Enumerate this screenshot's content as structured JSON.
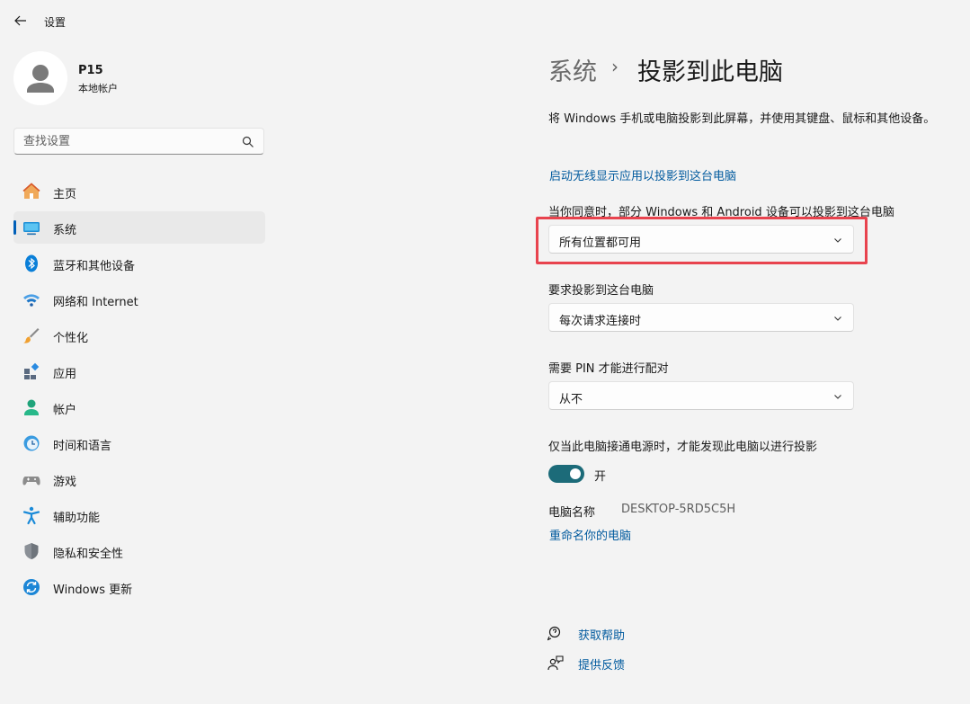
{
  "window": {
    "title": "设置"
  },
  "user": {
    "name": "P15",
    "account_type": "本地帐户"
  },
  "search": {
    "placeholder": "查找设置"
  },
  "sidebar": {
    "items": [
      {
        "label": "主页",
        "icon": "home-icon"
      },
      {
        "label": "系统",
        "icon": "system-icon",
        "active": true
      },
      {
        "label": "蓝牙和其他设备",
        "icon": "bluetooth-icon"
      },
      {
        "label": "网络和 Internet",
        "icon": "wifi-icon"
      },
      {
        "label": "个性化",
        "icon": "brush-icon"
      },
      {
        "label": "应用",
        "icon": "apps-icon"
      },
      {
        "label": "帐户",
        "icon": "account-icon"
      },
      {
        "label": "时间和语言",
        "icon": "time-language-icon"
      },
      {
        "label": "游戏",
        "icon": "gamepad-icon"
      },
      {
        "label": "辅助功能",
        "icon": "accessibility-icon"
      },
      {
        "label": "隐私和安全性",
        "icon": "shield-icon"
      },
      {
        "label": "Windows 更新",
        "icon": "update-icon"
      }
    ]
  },
  "breadcrumb": {
    "parent": "系统",
    "separator": "›",
    "current": "投影到此电脑"
  },
  "main": {
    "description": "将 Windows 手机或电脑投影到此屏幕，并使用其键盘、鼠标和其他设备。",
    "wireless_link": "启动无线显示应用以投影到这台电脑",
    "availability": {
      "label": "当你同意时，部分 Windows 和 Android 设备可以投影到这台电脑",
      "value": "所有位置都可用"
    },
    "ask_project": {
      "label": "要求投影到这台电脑",
      "value": "每次请求连接时"
    },
    "require_pin": {
      "label": "需要 PIN 才能进行配对",
      "value": "从不"
    },
    "power_only": {
      "label": "仅当此电脑接通电源时，才能发现此电脑以进行投影",
      "state": "开",
      "on": true
    },
    "pc_name": {
      "label": "电脑名称",
      "value": "DESKTOP-5RD5C5H",
      "rename_link": "重命名你的电脑"
    },
    "help": {
      "get_help": "获取帮助",
      "feedback": "提供反馈"
    }
  },
  "colors": {
    "accent": "#005fb8",
    "toggle_on": "#1c6b79",
    "highlight": "#e8434e",
    "link": "#005a9e"
  }
}
